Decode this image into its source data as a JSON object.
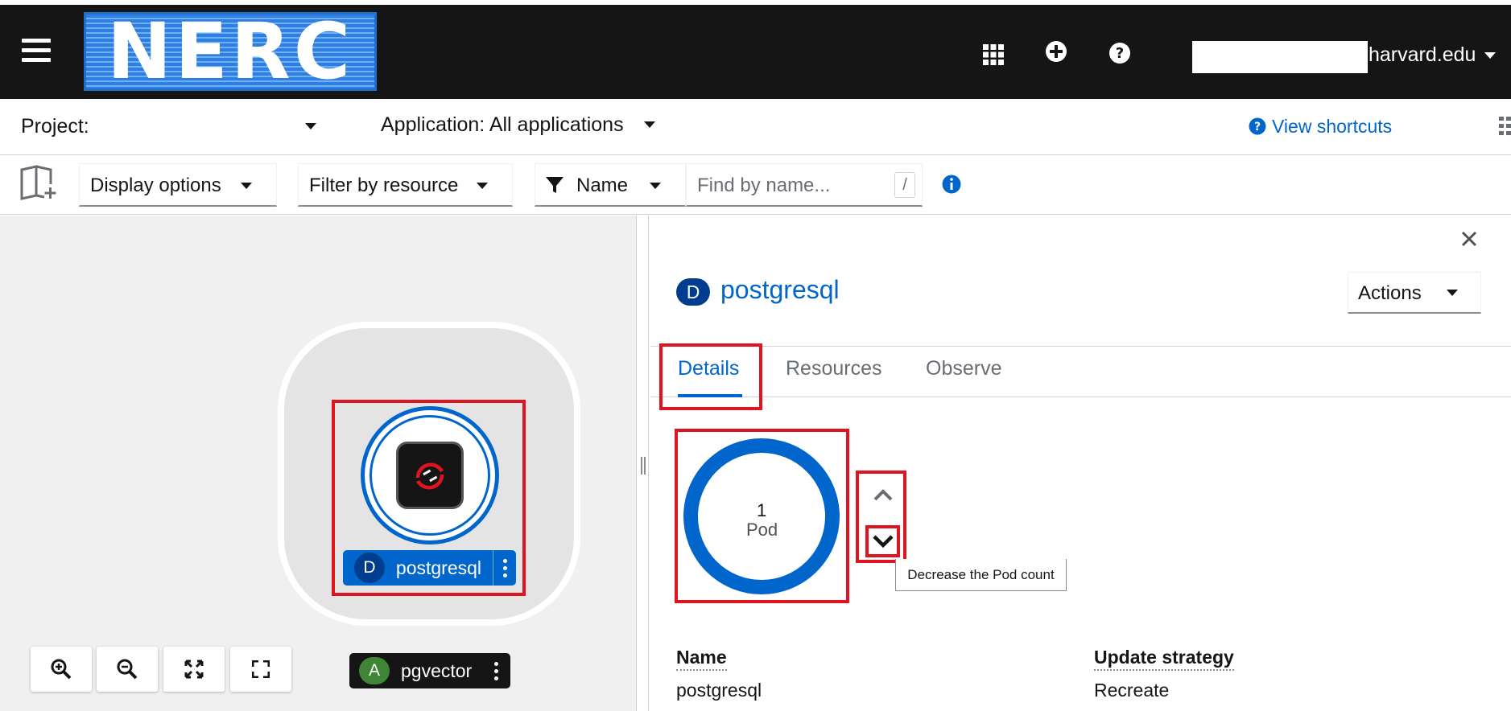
{
  "masthead": {
    "logo_text": "NERC",
    "user_domain": "harvard.edu",
    "icons": [
      "grid-icon",
      "plus-circle-icon",
      "question-circle-icon"
    ]
  },
  "project_bar": {
    "project_label": "Project:",
    "application_label": "Application: All applications",
    "view_shortcuts": "View shortcuts"
  },
  "toolbar": {
    "display_options": "Display options",
    "filter_by_resource": "Filter by resource",
    "filter_type": "Name",
    "search_placeholder": "Find by name...",
    "search_shortcut": "/"
  },
  "topology": {
    "node": {
      "badge": "D",
      "name": "postgresql"
    },
    "app": {
      "badge": "A",
      "name": "pgvector"
    }
  },
  "panel": {
    "resource_badge": "D",
    "resource_name": "postgresql",
    "actions_label": "Actions",
    "tabs": [
      {
        "label": "Details",
        "active": true
      },
      {
        "label": "Resources",
        "active": false
      },
      {
        "label": "Observe",
        "active": false
      }
    ],
    "pod_count": "1",
    "pod_label": "Pod",
    "tooltip": "Decrease the Pod count",
    "fields": {
      "name_label": "Name",
      "name_value": "postgresql",
      "strategy_label": "Update strategy",
      "strategy_value": "Recreate"
    }
  },
  "colors": {
    "masthead_bg": "#151515",
    "accent_blue": "#0066cc",
    "highlight_red": "#e0141e",
    "badge_navy": "#003d8f",
    "app_badge_green": "#3e8635"
  }
}
